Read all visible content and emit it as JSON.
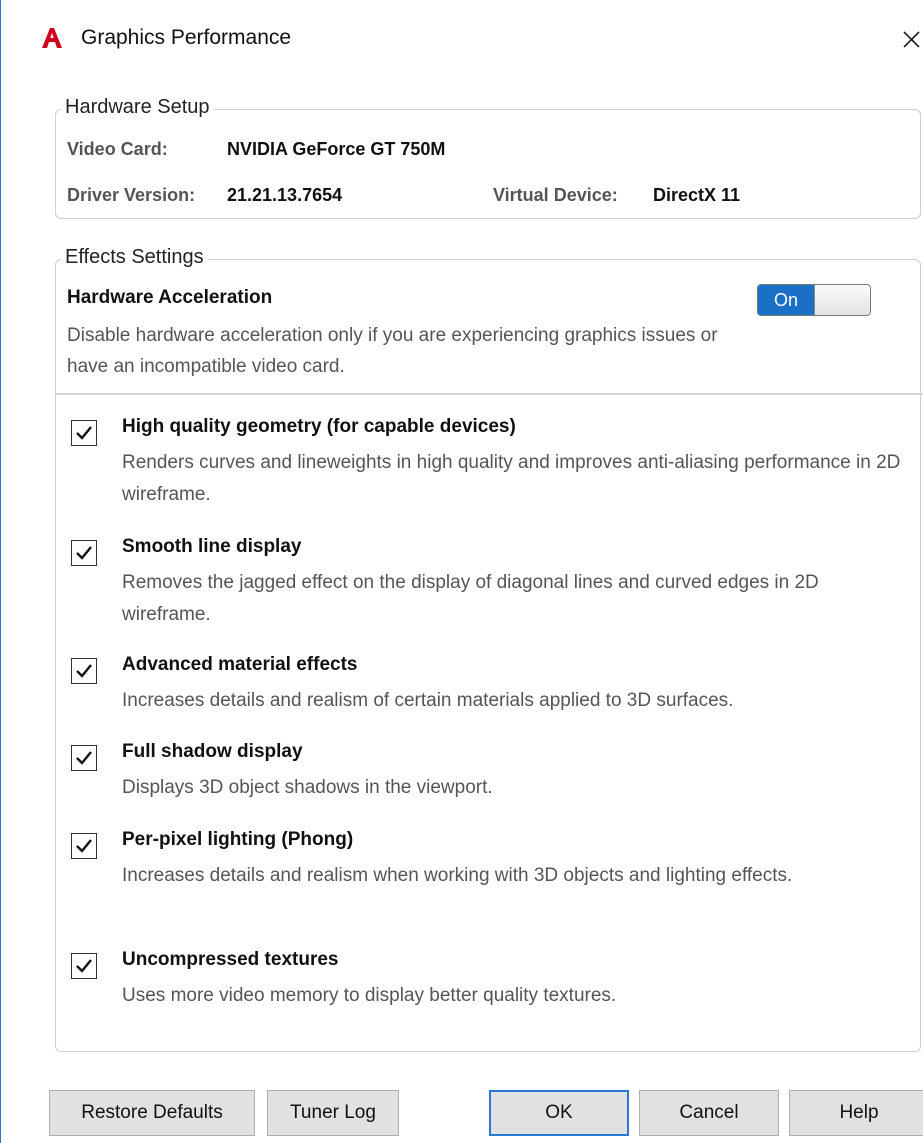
{
  "window": {
    "title": "Graphics Performance",
    "logo_icon": "autocad-logo-icon",
    "close_glyph": "×",
    "accent_color": "#2b78c6",
    "logo_color": "#d0021b"
  },
  "hardware_setup": {
    "title": "Hardware Setup",
    "video_card_label": "Video Card:",
    "video_card_value": "NVIDIA GeForce GT 750M",
    "driver_version_label": "Driver Version:",
    "driver_version_value": "21.21.13.7654",
    "virtual_device_label": "Virtual Device:",
    "virtual_device_value": "DirectX 11"
  },
  "effects_settings": {
    "title": "Effects Settings",
    "hardware_acceleration": {
      "title": "Hardware Acceleration",
      "description": "Disable hardware acceleration only if you are experiencing graphics issues or have an incompatible video card.",
      "toggle_label": "On",
      "enabled": true
    },
    "effects": [
      {
        "title": "High quality geometry (for capable devices)",
        "description": "Renders curves and lineweights in high quality and improves anti-aliasing performance in 2D wireframe.",
        "checked": true
      },
      {
        "title": "Smooth line display",
        "description": "Removes the jagged effect on the display of diagonal lines and curved edges in 2D wireframe.",
        "checked": true
      },
      {
        "title": "Advanced material effects",
        "description": "Increases details and realism of certain materials applied to 3D surfaces.",
        "checked": true
      },
      {
        "title": "Full shadow display",
        "description": "Displays 3D object shadows in the viewport.",
        "checked": true
      },
      {
        "title": "Per-pixel lighting (Phong)",
        "description": "Increases details and realism when working with 3D objects and lighting effects.",
        "checked": true
      },
      {
        "title": "Uncompressed textures",
        "description": "Uses more video memory to display better quality textures.",
        "checked": true
      }
    ]
  },
  "buttons": {
    "restore_defaults": "Restore Defaults",
    "tuner_log": "Tuner Log",
    "ok": "OK",
    "cancel": "Cancel",
    "help": "Help"
  }
}
